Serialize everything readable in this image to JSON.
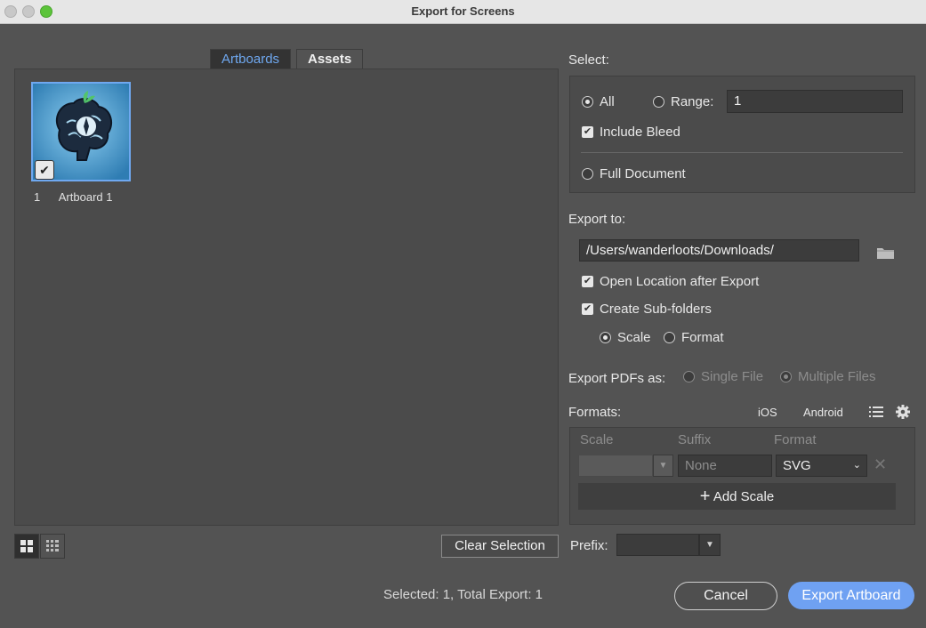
{
  "window": {
    "title": "Export for Screens"
  },
  "tabs": [
    {
      "label": "Artboards",
      "active": true
    },
    {
      "label": "Assets",
      "active": false
    }
  ],
  "artboard": {
    "number": "1",
    "name": "Artboard 1",
    "selected": true
  },
  "footer": {
    "clear_selection": "Clear Selection",
    "prefix_label": "Prefix:",
    "prefix_value": "",
    "status": "Selected: 1, Total Export: 1",
    "cancel": "Cancel",
    "export": "Export Artboard"
  },
  "select": {
    "heading": "Select:",
    "all_label": "All",
    "range_label": "Range:",
    "range_value": "1",
    "include_bleed": "Include Bleed",
    "full_document": "Full Document"
  },
  "export_to": {
    "heading": "Export to:",
    "path": "/Users/wanderloots/Downloads/",
    "open_location": "Open Location after Export",
    "create_subfolders": "Create Sub-folders",
    "scale_label": "Scale",
    "format_label": "Format"
  },
  "pdfs": {
    "heading": "Export PDFs as:",
    "single": "Single File",
    "multiple": "Multiple Files"
  },
  "formats": {
    "heading": "Formats:",
    "ios": "iOS",
    "android": "Android",
    "col_scale": "Scale",
    "col_suffix": "Suffix",
    "col_format": "Format",
    "suffix_placeholder": "None",
    "format_value": "SVG",
    "add_scale": "Add Scale"
  },
  "colors": {
    "accent": "#6fa8f0",
    "export_button": "#6fa1f2",
    "background": "#535353"
  }
}
